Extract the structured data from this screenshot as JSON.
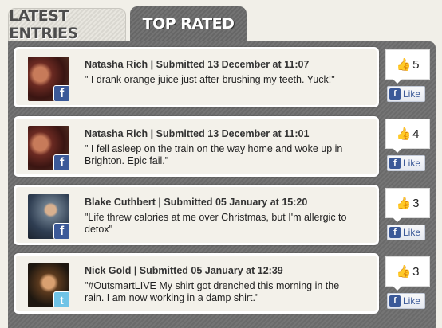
{
  "tabs": {
    "latest": "LATEST ENTRIES",
    "top_rated": "TOP RATED"
  },
  "entries": [
    {
      "author": "Natasha Rich",
      "submitted": "Submitted 13 December at 11:07",
      "text": "\" I drank orange juice just after brushing my teeth. Yuck!\"",
      "source": "facebook",
      "likes": "5",
      "like_label": "Like"
    },
    {
      "author": "Natasha Rich",
      "submitted": "Submitted 13 December at 11:01",
      "text": "\" I fell asleep on the train on the way home and woke up in Brighton. Epic fail.\"",
      "source": "facebook",
      "likes": "4",
      "like_label": "Like"
    },
    {
      "author": "Blake Cuthbert",
      "submitted": "Submitted 05 January at 15:20",
      "text": "\"Life threw calories at me over Christmas, but I'm allergic to detox\"",
      "source": "facebook",
      "likes": "3",
      "like_label": "Like"
    },
    {
      "author": "Nick Gold",
      "submitted": "Submitted 05 January at 12:39",
      "text": "\"#OutsmartLIVE My shirt got drenched this morning in the rain. I am now working in a damp shirt.\"",
      "source": "twitter",
      "likes": "3",
      "like_label": "Like"
    }
  ],
  "icons": {
    "facebook": "f",
    "twitter": "t",
    "thumbs_up": "👍"
  },
  "colors": {
    "facebook": "#3b5998",
    "twitter": "#6fc3e6",
    "panel": "#6a6a6a"
  }
}
